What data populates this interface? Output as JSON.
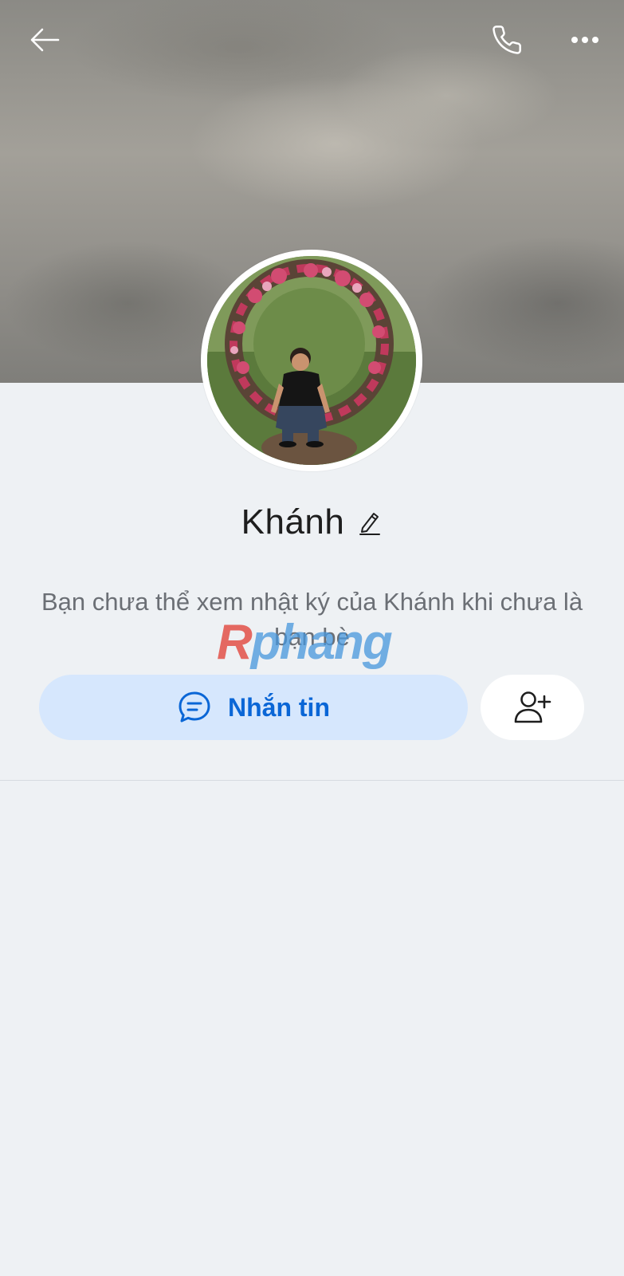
{
  "header": {
    "back_icon": "arrow-left-icon",
    "call_icon": "phone-icon",
    "more_icon": "more-horizontal-icon"
  },
  "profile": {
    "name": "Khánh",
    "edit_icon": "pencil-icon",
    "notice": "Bạn chưa thể xem nhật ký của Khánh khi chưa là bạn bè"
  },
  "watermark": {
    "first": "R",
    "rest": "phang"
  },
  "actions": {
    "message_label": "Nhắn tin",
    "message_icon": "chat-bubble-icon",
    "add_friend_icon": "add-user-icon"
  },
  "colors": {
    "accent": "#0a66d6",
    "message_button_bg": "#d6e7fd",
    "page_bg": "#eef1f4"
  }
}
